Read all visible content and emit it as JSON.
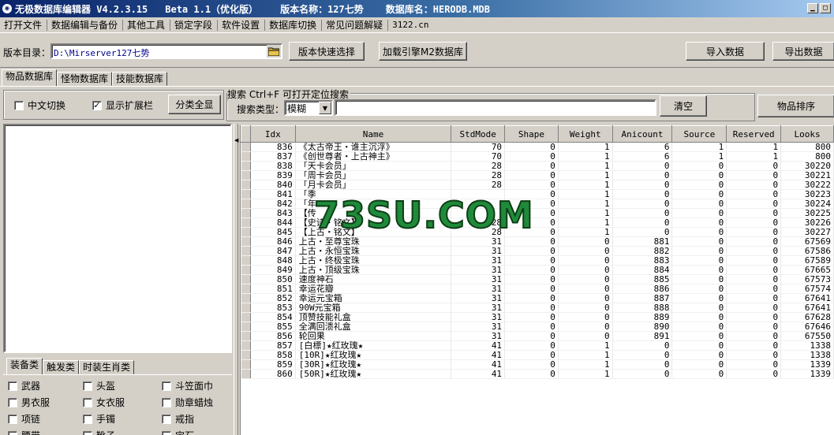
{
  "title": {
    "app": "无极数据库编辑器 V4.2.3.15",
    "beta": "Beta 1.1（优化版）",
    "version_name": "版本名称：127七势",
    "db_name": "数据库名：HERODB.MDB"
  },
  "menu": [
    "打开文件",
    "数据编辑与备份",
    "其他工具",
    "锁定字段",
    "软件设置",
    "数据库切换",
    "常见问题解疑",
    "3122.cn"
  ],
  "toolbar": {
    "dir_label": "版本目录：",
    "dir_value": "D:\\Mirserver127七势",
    "quick_select": "版本快速选择",
    "load_engine": "加载引擎M2数据库",
    "import": "导入数据",
    "export": "导出数据"
  },
  "tabs": [
    "物品数据库",
    "怪物数据库",
    "技能数据库"
  ],
  "options": {
    "cn_switch": "中文切换",
    "cn_switch_checked": false,
    "show_ext": "显示扩展栏",
    "show_ext_checked": true,
    "classify_all": "分类全显"
  },
  "search": {
    "legend": "搜索  Ctrl+F 可打开定位搜索",
    "type_label": "搜索类型：",
    "type_value": "模糊",
    "query": "",
    "clear": "清空",
    "sort": "物品排序"
  },
  "category_tabs": [
    "装备类",
    "触发类",
    "时装生肖类"
  ],
  "categories": [
    [
      "武器",
      "头盔",
      "斗笠面巾"
    ],
    [
      "男衣服",
      "女衣服",
      "勋章蜡烛"
    ],
    [
      "项链",
      "手镯",
      "戒指"
    ],
    [
      "腰带",
      "靴子",
      "宝石"
    ]
  ],
  "grid": {
    "columns": [
      "Idx",
      "Name",
      "StdMode",
      "Shape",
      "Weight",
      "Anicount",
      "Source",
      "Reserved",
      "Looks"
    ],
    "rows": [
      [
        "836",
        "《太古帝王・谁主沉浮》",
        "70",
        "0",
        "1",
        "6",
        "1",
        "1",
        "800"
      ],
      [
        "837",
        "《创世尊者・上古神主》",
        "70",
        "0",
        "1",
        "6",
        "1",
        "1",
        "800"
      ],
      [
        "838",
        "「天卡会员」",
        "28",
        "0",
        "1",
        "0",
        "0",
        "0",
        "30220"
      ],
      [
        "839",
        "「周卡会员」",
        "28",
        "0",
        "1",
        "0",
        "0",
        "0",
        "30221"
      ],
      [
        "840",
        "「月卡会员」",
        "28",
        "0",
        "1",
        "0",
        "0",
        "0",
        "30222"
      ],
      [
        "841",
        "「季",
        "",
        "0",
        "1",
        "0",
        "0",
        "0",
        "30223"
      ],
      [
        "842",
        "「年",
        "",
        "0",
        "1",
        "0",
        "0",
        "0",
        "30224"
      ],
      [
        "843",
        "【传",
        "",
        "0",
        "1",
        "0",
        "0",
        "0",
        "30225"
      ],
      [
        "844",
        "【史诗・铭文】",
        "28",
        "0",
        "1",
        "0",
        "0",
        "0",
        "30226"
      ],
      [
        "845",
        "【上古・铭文】",
        "28",
        "0",
        "1",
        "0",
        "0",
        "0",
        "30227"
      ],
      [
        "846",
        "上古・至尊宝珠",
        "31",
        "0",
        "0",
        "881",
        "0",
        "0",
        "67569"
      ],
      [
        "847",
        "上古・永恒宝珠",
        "31",
        "0",
        "0",
        "882",
        "0",
        "0",
        "67586"
      ],
      [
        "848",
        "上古・终极宝珠",
        "31",
        "0",
        "0",
        "883",
        "0",
        "0",
        "67589"
      ],
      [
        "849",
        "上古・顶级宝珠",
        "31",
        "0",
        "0",
        "884",
        "0",
        "0",
        "67665"
      ],
      [
        "850",
        "速度神石",
        "31",
        "0",
        "0",
        "885",
        "0",
        "0",
        "67573"
      ],
      [
        "851",
        "幸运花瓣",
        "31",
        "0",
        "0",
        "886",
        "0",
        "0",
        "67574"
      ],
      [
        "852",
        "幸运元宝箱",
        "31",
        "0",
        "0",
        "887",
        "0",
        "0",
        "67641"
      ],
      [
        "853",
        "90W元宝箱",
        "31",
        "0",
        "0",
        "888",
        "0",
        "0",
        "67641"
      ],
      [
        "854",
        "顶赞技能礼盒",
        "31",
        "0",
        "0",
        "889",
        "0",
        "0",
        "67628"
      ],
      [
        "855",
        "全满回溃礼盒",
        "31",
        "0",
        "0",
        "890",
        "0",
        "0",
        "67646"
      ],
      [
        "856",
        "轮回果",
        "31",
        "0",
        "0",
        "891",
        "0",
        "0",
        "67550"
      ],
      [
        "857",
        "[白標]★红玫瑰★",
        "41",
        "0",
        "1",
        "0",
        "0",
        "0",
        "1338"
      ],
      [
        "858",
        "[10R]★红玫瑰★",
        "41",
        "0",
        "1",
        "0",
        "0",
        "0",
        "1338"
      ],
      [
        "859",
        "[30R]★红玫瑰★",
        "41",
        "0",
        "1",
        "0",
        "0",
        "0",
        "1339"
      ],
      [
        "860",
        "[50R]★红玫瑰★",
        "41",
        "0",
        "1",
        "0",
        "0",
        "0",
        "1339"
      ]
    ]
  },
  "watermark": "73SU.COM"
}
